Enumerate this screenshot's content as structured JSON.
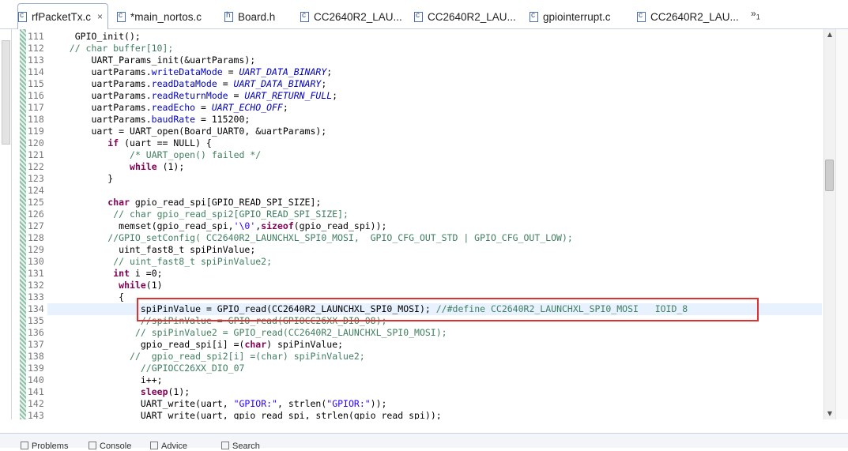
{
  "tabs": [
    {
      "label": "rfPacketTx.c",
      "icon": "c-file-icon",
      "active": true
    },
    {
      "label": "*main_nortos.c",
      "icon": "c-file-icon"
    },
    {
      "label": "Board.h",
      "icon": "h-file-icon"
    },
    {
      "label": "CC2640R2_LAU...",
      "icon": "c-file-icon"
    },
    {
      "label": "CC2640R2_LAU...",
      "icon": "c-file-icon"
    },
    {
      "label": "gpiointerrupt.c",
      "icon": "c-file-icon"
    },
    {
      "label": "CC2640R2_LAU...",
      "icon": "c-file-icon"
    }
  ],
  "tab_close": "×",
  "tab_overflow": {
    "symbol": "»",
    "count": "1"
  },
  "code_lines": [
    {
      "n": "111",
      "indent": 4,
      "segs": [
        [
          "t",
          "GPIO_init();"
        ]
      ]
    },
    {
      "n": "112",
      "indent": 3,
      "segs": [
        [
          "c",
          "// char buffer[10];"
        ]
      ]
    },
    {
      "n": "113",
      "indent": 7,
      "segs": [
        [
          "t",
          "UART_Params_init(&uartParams);"
        ]
      ]
    },
    {
      "n": "114",
      "indent": 7,
      "segs": [
        [
          "t",
          "uartParams."
        ],
        [
          "f",
          "writeDataMode"
        ],
        [
          "t",
          " = "
        ],
        [
          "i",
          "UART_DATA_BINARY"
        ],
        [
          "t",
          ";"
        ]
      ]
    },
    {
      "n": "115",
      "indent": 7,
      "segs": [
        [
          "t",
          "uartParams."
        ],
        [
          "f",
          "readDataMode"
        ],
        [
          "t",
          " = "
        ],
        [
          "i",
          "UART_DATA_BINARY"
        ],
        [
          "t",
          ";"
        ]
      ]
    },
    {
      "n": "116",
      "indent": 7,
      "segs": [
        [
          "t",
          "uartParams."
        ],
        [
          "f",
          "readReturnMode"
        ],
        [
          "t",
          " = "
        ],
        [
          "i",
          "UART_RETURN_FULL"
        ],
        [
          "t",
          ";"
        ]
      ]
    },
    {
      "n": "117",
      "indent": 7,
      "segs": [
        [
          "t",
          "uartParams."
        ],
        [
          "f",
          "readEcho"
        ],
        [
          "t",
          " = "
        ],
        [
          "i",
          "UART_ECHO_OFF"
        ],
        [
          "t",
          ";"
        ]
      ]
    },
    {
      "n": "118",
      "indent": 7,
      "segs": [
        [
          "t",
          "uartParams."
        ],
        [
          "f",
          "baudRate"
        ],
        [
          "t",
          " = 115200;"
        ]
      ]
    },
    {
      "n": "119",
      "indent": 7,
      "segs": [
        [
          "t",
          "uart = UART_open(Board_UART0, &uartParams);"
        ]
      ]
    },
    {
      "n": "120",
      "indent": 10,
      "segs": [
        [
          "k",
          "if"
        ],
        [
          "t",
          " (uart == NULL) {"
        ]
      ]
    },
    {
      "n": "121",
      "indent": 14,
      "segs": [
        [
          "c",
          "/* UART_open() failed */"
        ]
      ]
    },
    {
      "n": "122",
      "indent": 14,
      "segs": [
        [
          "k",
          "while"
        ],
        [
          "t",
          " (1);"
        ]
      ]
    },
    {
      "n": "123",
      "indent": 10,
      "segs": [
        [
          "t",
          "}"
        ]
      ]
    },
    {
      "n": "124",
      "indent": 0,
      "segs": []
    },
    {
      "n": "125",
      "indent": 10,
      "segs": [
        [
          "k",
          "char"
        ],
        [
          "t",
          " gpio_read_spi[GPIO_READ_SPI_SIZE];"
        ]
      ]
    },
    {
      "n": "126",
      "indent": 11,
      "segs": [
        [
          "c",
          "// char gpio_read_spi2[GPIO_READ_SPI_SIZE];"
        ]
      ]
    },
    {
      "n": "127",
      "indent": 12,
      "segs": [
        [
          "t",
          "memset(gpio_read_spi,"
        ],
        [
          "s",
          "'\\0'"
        ],
        [
          "t",
          ","
        ],
        [
          "k",
          "sizeof"
        ],
        [
          "t",
          "(gpio_read_spi));"
        ]
      ]
    },
    {
      "n": "128",
      "indent": 10,
      "segs": [
        [
          "c",
          "//GPIO_setConfig( CC2640R2_LAUNCHXL_SPI0_MOSI,  GPIO_CFG_OUT_STD | GPIO_CFG_OUT_LOW);"
        ]
      ]
    },
    {
      "n": "129",
      "indent": 12,
      "segs": [
        [
          "t",
          "uint_fast8_t spiPinValue;"
        ]
      ]
    },
    {
      "n": "130",
      "indent": 11,
      "segs": [
        [
          "c",
          "// uint_fast8_t spiPinValue2;"
        ]
      ]
    },
    {
      "n": "131",
      "indent": 11,
      "segs": [
        [
          "k",
          "int"
        ],
        [
          "t",
          " i =0;"
        ]
      ]
    },
    {
      "n": "132",
      "indent": 12,
      "segs": [
        [
          "k",
          "while"
        ],
        [
          "t",
          "(1)"
        ]
      ]
    },
    {
      "n": "133",
      "indent": 12,
      "segs": [
        [
          "t",
          "{"
        ]
      ]
    },
    {
      "n": "134",
      "indent": 16,
      "segs": [
        [
          "t",
          "spiPinValue = GPIO_read(CC2640R2_LAUNCHXL_SPI0_MOSI); "
        ],
        [
          "c",
          "//#define CC2640R2_LAUNCHXL_SPI0_MOSI   IOID_8"
        ]
      ],
      "current": true
    },
    {
      "n": "135",
      "indent": 16,
      "segs": [
        [
          "c",
          "//spiPinValue = GPIO_read(GPIOCC26XX_DIO_08);"
        ]
      ]
    },
    {
      "n": "136",
      "indent": 15,
      "segs": [
        [
          "c",
          "// spiPinValue2 = GPIO_read(CC2640R2_LAUNCHXL_SPI0_MOSI);"
        ]
      ]
    },
    {
      "n": "137",
      "indent": 16,
      "segs": [
        [
          "t",
          "gpio_read_spi[i] =("
        ],
        [
          "k",
          "char"
        ],
        [
          "t",
          ") spiPinValue;"
        ]
      ]
    },
    {
      "n": "138",
      "indent": 14,
      "segs": [
        [
          "c",
          "//  gpio_read_spi2[i] =(char) spiPinValue2;"
        ]
      ]
    },
    {
      "n": "139",
      "indent": 16,
      "segs": [
        [
          "c",
          "//GPIOCC26XX_DIO_07"
        ]
      ]
    },
    {
      "n": "140",
      "indent": 16,
      "segs": [
        [
          "t",
          "i++;"
        ]
      ]
    },
    {
      "n": "141",
      "indent": 16,
      "segs": [
        [
          "k",
          "sleep"
        ],
        [
          "t",
          "(1);"
        ]
      ]
    },
    {
      "n": "142",
      "indent": 16,
      "segs": [
        [
          "t",
          "UART_write(uart, "
        ],
        [
          "s",
          "\"GPIOR:\""
        ],
        [
          "t",
          ", strlen("
        ],
        [
          "s",
          "\"GPIOR:\""
        ],
        [
          "t",
          "));"
        ]
      ]
    },
    {
      "n": "143",
      "indent": 16,
      "segs": [
        [
          "t",
          "UART_write(uart, gpio_read_spi, strlen(gpio_read_spi));"
        ]
      ]
    }
  ],
  "bottom_tabs": [
    {
      "label": "Problems",
      "icon": "problems-icon"
    },
    {
      "label": "Console",
      "icon": "console-icon"
    },
    {
      "label": "Advice",
      "icon": "advice-icon"
    },
    {
      "label": "Search",
      "icon": "search-icon"
    }
  ],
  "colors": {
    "keyword": "#7f0055",
    "comment": "#3f7f5f",
    "field": "#0000c0",
    "string": "#2a00ff",
    "highlight_box": "#e03030"
  }
}
